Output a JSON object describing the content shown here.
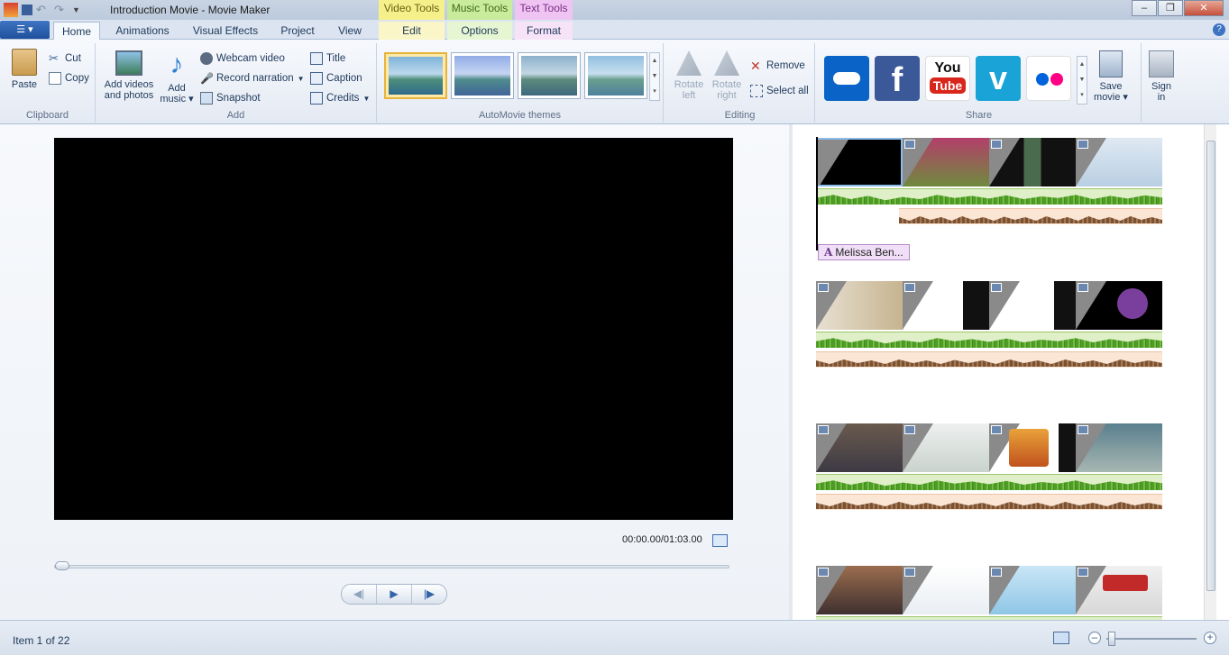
{
  "window": {
    "title": "Introduction Movie - Movie Maker",
    "contextual_tabs": [
      "Video Tools",
      "Music Tools",
      "Text Tools"
    ]
  },
  "tabs": {
    "home": "Home",
    "animations": "Animations",
    "visual_effects": "Visual Effects",
    "project": "Project",
    "view": "View",
    "edit": "Edit",
    "options": "Options",
    "format": "Format"
  },
  "ribbon": {
    "clipboard": {
      "label": "Clipboard",
      "paste": "Paste",
      "cut": "Cut",
      "copy": "Copy"
    },
    "add": {
      "label": "Add",
      "add_videos_line1": "Add videos",
      "add_videos_line2": "and photos",
      "add_music_line1": "Add",
      "add_music_line2": "music",
      "webcam": "Webcam video",
      "narration": "Record narration",
      "snapshot": "Snapshot",
      "title": "Title",
      "caption": "Caption",
      "credits": "Credits"
    },
    "themes": {
      "label": "AutoMovie themes"
    },
    "editing": {
      "label": "Editing",
      "rotate_left_1": "Rotate",
      "rotate_left_2": "left",
      "rotate_right_1": "Rotate",
      "rotate_right_2": "right",
      "remove": "Remove",
      "select_all": "Select all"
    },
    "share": {
      "label": "Share",
      "save_movie_1": "Save",
      "save_movie_2": "movie",
      "sign_in_1": "Sign",
      "sign_in_2": "in",
      "services": [
        "onedrive",
        "facebook",
        "youtube",
        "vimeo",
        "flickr"
      ]
    }
  },
  "preview": {
    "timecode": "00:00.00/01:03.00",
    "position_fraction": 0
  },
  "storyboard": {
    "caption_label": "Melissa Ben...",
    "caption_glyph": "A"
  },
  "status": {
    "item_count": "Item 1 of 22"
  },
  "colors": {
    "accent": "#1e4f9c",
    "video_tools_tab": "#f6f08a",
    "music_tools_tab": "#c9ec9c",
    "text_tools_tab": "#efc3f2"
  }
}
